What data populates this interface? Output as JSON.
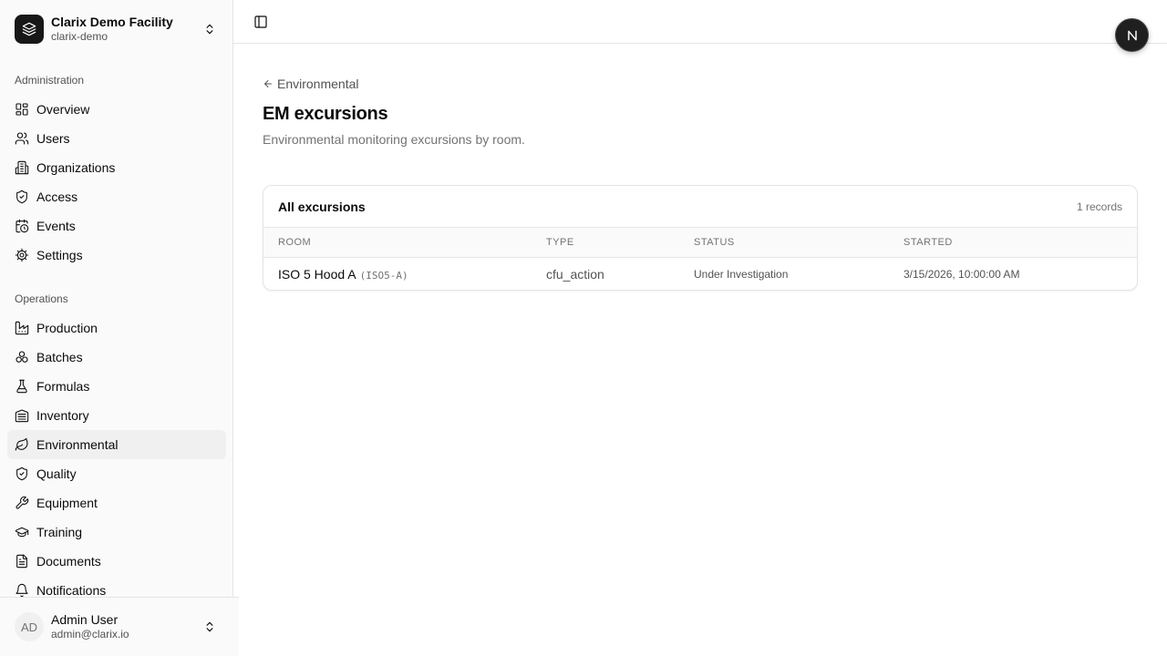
{
  "org": {
    "name": "Clarix Demo Facility",
    "slug": "clarix-demo"
  },
  "sidebar": {
    "admin_label": "Administration",
    "admin_items": [
      {
        "label": "Overview",
        "icon": "layout-grid-icon"
      },
      {
        "label": "Users",
        "icon": "users-icon"
      },
      {
        "label": "Organizations",
        "icon": "building-icon"
      },
      {
        "label": "Access",
        "icon": "shield-check-icon"
      },
      {
        "label": "Events",
        "icon": "calendar-clock-icon"
      },
      {
        "label": "Settings",
        "icon": "gear-icon"
      }
    ],
    "ops_label": "Operations",
    "ops_items": [
      {
        "label": "Production",
        "icon": "factory-icon"
      },
      {
        "label": "Batches",
        "icon": "boxes-icon"
      },
      {
        "label": "Formulas",
        "icon": "flask-icon"
      },
      {
        "label": "Inventory",
        "icon": "warehouse-icon"
      },
      {
        "label": "Environmental",
        "icon": "leaf-icon",
        "active": true
      },
      {
        "label": "Quality",
        "icon": "shield-check-icon"
      },
      {
        "label": "Equipment",
        "icon": "wrench-icon"
      },
      {
        "label": "Training",
        "icon": "graduation-cap-icon"
      },
      {
        "label": "Documents",
        "icon": "file-text-icon"
      },
      {
        "label": "Notifications",
        "icon": "bell-icon"
      }
    ]
  },
  "user": {
    "initials": "AD",
    "name": "Admin User",
    "email": "admin@clarix.io"
  },
  "fab": {
    "letter": "N"
  },
  "page": {
    "back_label": "Environmental",
    "title": "EM excursions",
    "subtitle": "Environmental monitoring excursions by room."
  },
  "table": {
    "title": "All excursions",
    "count": "1 records",
    "columns": [
      "Room",
      "Type",
      "Status",
      "Started"
    ],
    "rows": [
      {
        "room": "ISO 5 Hood A",
        "code": "(ISO5-A)",
        "type": "cfu_action",
        "status": "Under Investigation",
        "started": "3/15/2026, 10:00:00 AM"
      }
    ]
  },
  "colors": {
    "accent": "#171717",
    "border": "#e5e5e5",
    "muted": "#737373",
    "active_bg": "#f0f0f0"
  }
}
